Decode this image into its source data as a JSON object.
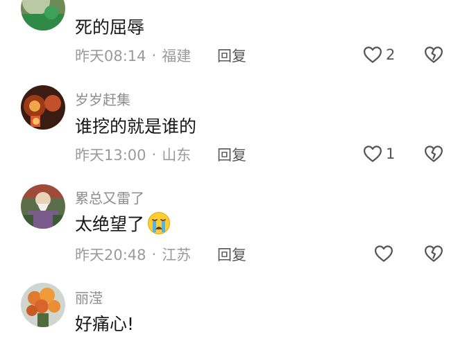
{
  "comments": [
    {
      "username": "",
      "text": "死的屈辱",
      "time": "昨天08:14",
      "location": "福建",
      "reply_label": "回复",
      "likes": "2",
      "avatar": "green-figure"
    },
    {
      "username": "岁岁赶集",
      "text": "谁挖的就是谁的",
      "time": "昨天13:00",
      "location": "山东",
      "reply_label": "回复",
      "likes": "1",
      "avatar": "glowing-statue"
    },
    {
      "username": "累总又雷了",
      "text": "太绝望了",
      "emoji": "loudly-crying-face",
      "time": "昨天20:48",
      "location": "江苏",
      "reply_label": "回复",
      "likes": "",
      "avatar": "old-sage"
    },
    {
      "username": "丽滢",
      "text": "好痛心!",
      "avatar": "flower-bouquet"
    }
  ],
  "separator": "·",
  "colors": {
    "username": "#8c8c8c",
    "text": "#161616",
    "meta": "#9a9a9a",
    "action": "#555555"
  }
}
